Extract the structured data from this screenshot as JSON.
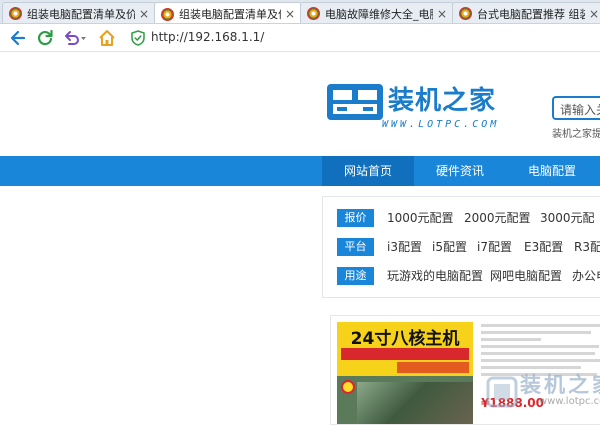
{
  "browser": {
    "tabs": [
      {
        "title": "组装电脑配置清单及价",
        "close": "×",
        "active": false
      },
      {
        "title": "组装电脑配置清单及价",
        "close": "×",
        "active": true
      },
      {
        "title": "电脑故障维修大全_电脑",
        "close": "×",
        "active": false
      },
      {
        "title": "台式电脑配置推荐 组装",
        "close": "×",
        "active": false
      }
    ],
    "address": {
      "url": "http://192.168.1.1/"
    },
    "icons": {
      "back": "back-arrow-icon",
      "refresh": "refresh-icon",
      "undo": "undo-icon",
      "home": "home-icon",
      "secure": "shield-check-icon"
    },
    "colors": {
      "accent_green": "#2e9c45",
      "accent_blue": "#1a7ccb",
      "home_orange": "#e8a21c",
      "undo_purple": "#7a4bc8"
    }
  },
  "site": {
    "brand": {
      "name": "装机之家",
      "subtitle": "WWW.LOTPC.COM"
    },
    "search": {
      "placeholder": "请输入关",
      "hint": "装机之家提"
    },
    "nav": [
      "网站首页",
      "硬件资讯",
      "电脑配置"
    ],
    "categories": [
      {
        "tag": "报价",
        "links": [
          "1000元配置",
          "2000元配置",
          "3000元配"
        ]
      },
      {
        "tag": "平台",
        "links": [
          "i3配置",
          "i5配置",
          "i7配置",
          "E3配置",
          "R3配"
        ]
      },
      {
        "tag": "用途",
        "links": [
          "玩游戏的电脑配置",
          "网吧电脑配置",
          "办公电"
        ]
      }
    ],
    "ad": {
      "headline": "24寸八核主机",
      "price": "¥1888.00"
    },
    "watermark": {
      "text": "装机之家",
      "sub": "www.lotpc.com"
    },
    "colors": {
      "nav_bg": "#1a86d9",
      "nav_active": "#1070bd",
      "tag_bg": "#1a86d9",
      "ad_yellow": "#f7d21b",
      "ad_red": "#d9272e"
    }
  }
}
